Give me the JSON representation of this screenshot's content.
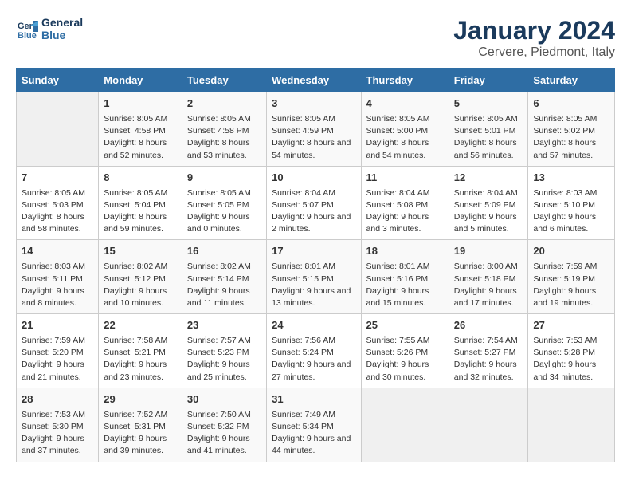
{
  "header": {
    "logo_line1": "General",
    "logo_line2": "Blue",
    "title": "January 2024",
    "subtitle": "Cervere, Piedmont, Italy"
  },
  "days_of_week": [
    "Sunday",
    "Monday",
    "Tuesday",
    "Wednesday",
    "Thursday",
    "Friday",
    "Saturday"
  ],
  "weeks": [
    [
      {
        "day": "",
        "sunrise": "",
        "sunset": "",
        "daylight": "",
        "empty": true
      },
      {
        "day": "1",
        "sunrise": "8:05 AM",
        "sunset": "4:58 PM",
        "daylight": "8 hours and 52 minutes."
      },
      {
        "day": "2",
        "sunrise": "8:05 AM",
        "sunset": "4:58 PM",
        "daylight": "8 hours and 53 minutes."
      },
      {
        "day": "3",
        "sunrise": "8:05 AM",
        "sunset": "4:59 PM",
        "daylight": "8 hours and 54 minutes."
      },
      {
        "day": "4",
        "sunrise": "8:05 AM",
        "sunset": "5:00 PM",
        "daylight": "8 hours and 54 minutes."
      },
      {
        "day": "5",
        "sunrise": "8:05 AM",
        "sunset": "5:01 PM",
        "daylight": "8 hours and 56 minutes."
      },
      {
        "day": "6",
        "sunrise": "8:05 AM",
        "sunset": "5:02 PM",
        "daylight": "8 hours and 57 minutes."
      }
    ],
    [
      {
        "day": "7",
        "sunrise": "8:05 AM",
        "sunset": "5:03 PM",
        "daylight": "8 hours and 58 minutes."
      },
      {
        "day": "8",
        "sunrise": "8:05 AM",
        "sunset": "5:04 PM",
        "daylight": "8 hours and 59 minutes."
      },
      {
        "day": "9",
        "sunrise": "8:05 AM",
        "sunset": "5:05 PM",
        "daylight": "9 hours and 0 minutes."
      },
      {
        "day": "10",
        "sunrise": "8:04 AM",
        "sunset": "5:07 PM",
        "daylight": "9 hours and 2 minutes."
      },
      {
        "day": "11",
        "sunrise": "8:04 AM",
        "sunset": "5:08 PM",
        "daylight": "9 hours and 3 minutes."
      },
      {
        "day": "12",
        "sunrise": "8:04 AM",
        "sunset": "5:09 PM",
        "daylight": "9 hours and 5 minutes."
      },
      {
        "day": "13",
        "sunrise": "8:03 AM",
        "sunset": "5:10 PM",
        "daylight": "9 hours and 6 minutes."
      }
    ],
    [
      {
        "day": "14",
        "sunrise": "8:03 AM",
        "sunset": "5:11 PM",
        "daylight": "9 hours and 8 minutes."
      },
      {
        "day": "15",
        "sunrise": "8:02 AM",
        "sunset": "5:12 PM",
        "daylight": "9 hours and 10 minutes."
      },
      {
        "day": "16",
        "sunrise": "8:02 AM",
        "sunset": "5:14 PM",
        "daylight": "9 hours and 11 minutes."
      },
      {
        "day": "17",
        "sunrise": "8:01 AM",
        "sunset": "5:15 PM",
        "daylight": "9 hours and 13 minutes."
      },
      {
        "day": "18",
        "sunrise": "8:01 AM",
        "sunset": "5:16 PM",
        "daylight": "9 hours and 15 minutes."
      },
      {
        "day": "19",
        "sunrise": "8:00 AM",
        "sunset": "5:18 PM",
        "daylight": "9 hours and 17 minutes."
      },
      {
        "day": "20",
        "sunrise": "7:59 AM",
        "sunset": "5:19 PM",
        "daylight": "9 hours and 19 minutes."
      }
    ],
    [
      {
        "day": "21",
        "sunrise": "7:59 AM",
        "sunset": "5:20 PM",
        "daylight": "9 hours and 21 minutes."
      },
      {
        "day": "22",
        "sunrise": "7:58 AM",
        "sunset": "5:21 PM",
        "daylight": "9 hours and 23 minutes."
      },
      {
        "day": "23",
        "sunrise": "7:57 AM",
        "sunset": "5:23 PM",
        "daylight": "9 hours and 25 minutes."
      },
      {
        "day": "24",
        "sunrise": "7:56 AM",
        "sunset": "5:24 PM",
        "daylight": "9 hours and 27 minutes."
      },
      {
        "day": "25",
        "sunrise": "7:55 AM",
        "sunset": "5:26 PM",
        "daylight": "9 hours and 30 minutes."
      },
      {
        "day": "26",
        "sunrise": "7:54 AM",
        "sunset": "5:27 PM",
        "daylight": "9 hours and 32 minutes."
      },
      {
        "day": "27",
        "sunrise": "7:53 AM",
        "sunset": "5:28 PM",
        "daylight": "9 hours and 34 minutes."
      }
    ],
    [
      {
        "day": "28",
        "sunrise": "7:53 AM",
        "sunset": "5:30 PM",
        "daylight": "9 hours and 37 minutes."
      },
      {
        "day": "29",
        "sunrise": "7:52 AM",
        "sunset": "5:31 PM",
        "daylight": "9 hours and 39 minutes."
      },
      {
        "day": "30",
        "sunrise": "7:50 AM",
        "sunset": "5:32 PM",
        "daylight": "9 hours and 41 minutes."
      },
      {
        "day": "31",
        "sunrise": "7:49 AM",
        "sunset": "5:34 PM",
        "daylight": "9 hours and 44 minutes."
      },
      {
        "day": "",
        "sunrise": "",
        "sunset": "",
        "daylight": "",
        "empty": true
      },
      {
        "day": "",
        "sunrise": "",
        "sunset": "",
        "daylight": "",
        "empty": true
      },
      {
        "day": "",
        "sunrise": "",
        "sunset": "",
        "daylight": "",
        "empty": true
      }
    ]
  ],
  "labels": {
    "sunrise": "Sunrise:",
    "sunset": "Sunset:",
    "daylight": "Daylight:"
  }
}
